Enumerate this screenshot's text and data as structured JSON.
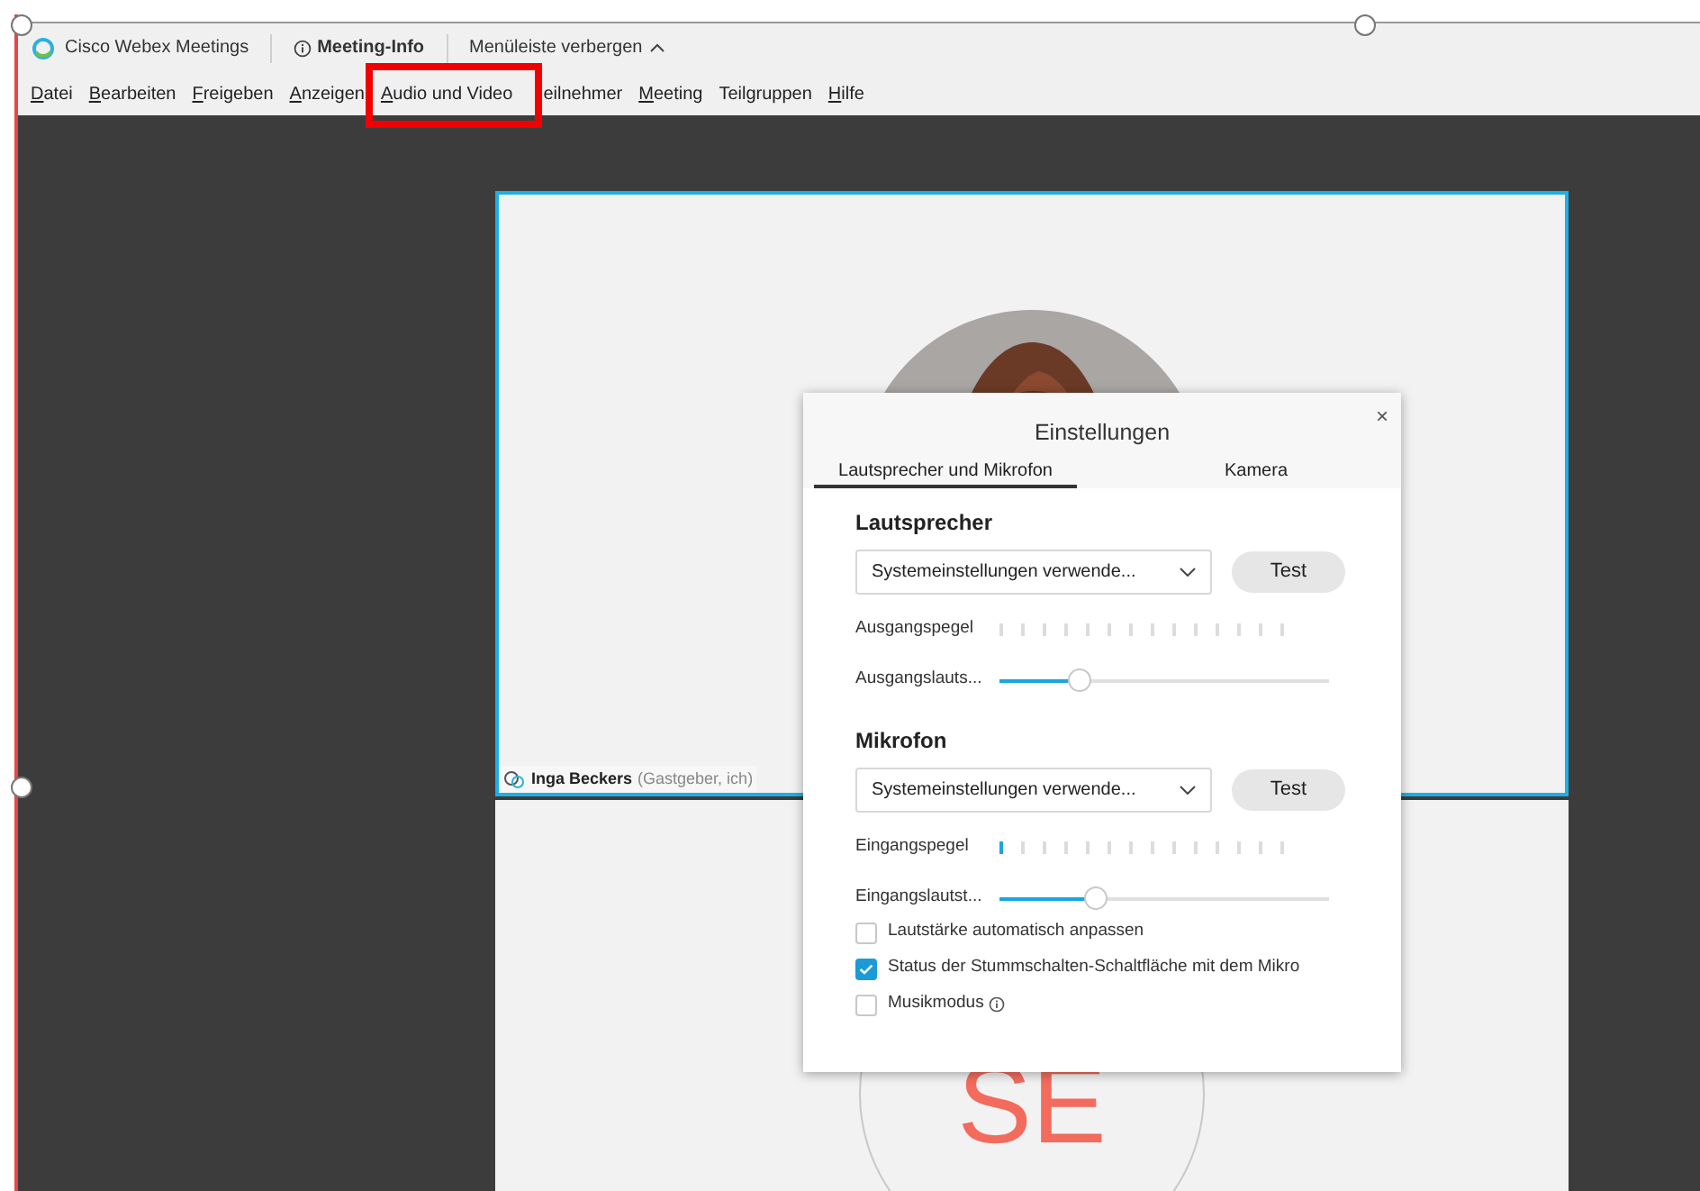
{
  "titlebar": {
    "app_name": "Cisco Webex Meetings",
    "meeting_info": "Meeting-Info",
    "hide_menu": "Menüleiste verbergen"
  },
  "menu": [
    {
      "label": "Datei",
      "mnemonic": true
    },
    {
      "label": "Bearbeiten",
      "mnemonic": true
    },
    {
      "label": "Freigeben",
      "mnemonic": true
    },
    {
      "label": "Anzeigen",
      "mnemonic": true
    },
    {
      "label": "Audio und Video",
      "mnemonic": true
    },
    {
      "label": "eilnehmer",
      "mnemonic": false
    },
    {
      "label": "Meeting",
      "mnemonic": true
    },
    {
      "label": "Teilgruppen",
      "mnemonic": false
    },
    {
      "label": "Hilfe",
      "mnemonic": true
    }
  ],
  "video_tiles": [
    {
      "participant": "Inga Beckers",
      "role": "(Gastgeber, ich)",
      "kind": "picture"
    },
    {
      "initials": "SE",
      "kind": "initials"
    }
  ],
  "dialog": {
    "title": "Einstellungen",
    "close": "×",
    "tabs": [
      {
        "label": "Lautsprecher und Mikrofon",
        "selected": true
      },
      {
        "label": "Kamera",
        "selected": false
      }
    ],
    "sections": [
      {
        "heading": "Lautsprecher",
        "device": "Systemeinstellungen verwende...",
        "test": "Test",
        "meter_label": "Ausgangspegel",
        "volume_label": "Ausgangslauts...",
        "volume": {
          "level": 0.24
        }
      },
      {
        "heading": "Mikrofon",
        "device": "Systemeinstellungen verwende...",
        "test": "Test",
        "meter_label": "Eingangspegel",
        "meter": {
          "level": 0.07
        },
        "volume_label": "Eingangslautst...",
        "volume": {
          "level": 0.29
        }
      }
    ],
    "options": [
      {
        "label": "Lautstärke automatisch anpassen",
        "checked": false,
        "info": false
      },
      {
        "label": "Status der Stummschalten-Schaltfläche mit dem Mikro",
        "checked": true,
        "info": false
      },
      {
        "label": "Musikmodus",
        "checked": false,
        "info": true
      }
    ]
  }
}
